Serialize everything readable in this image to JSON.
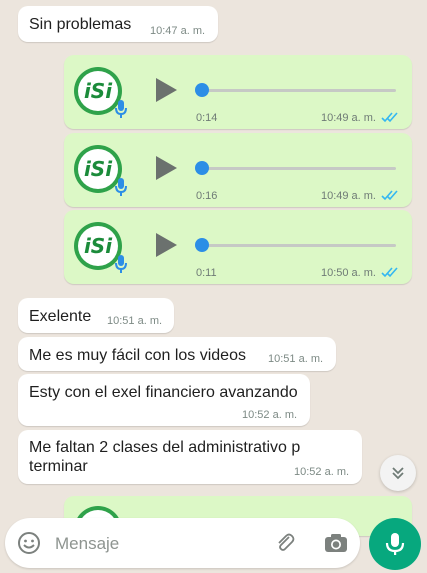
{
  "messages": [
    {
      "text": "Sin problemas",
      "time": "10:47 a. m."
    },
    {
      "text": "Exelente",
      "time": "10:51 a. m."
    },
    {
      "text": "Me es muy fácil con los videos",
      "time": "10:51 a. m."
    },
    {
      "text": "Esty con el exel financiero avanzando",
      "time": "10:52 a. m."
    },
    {
      "text_line1": "Me faltan 2 clases del administrativo p",
      "text_line2": "terminar",
      "time": "10:52 a. m."
    }
  ],
  "voice_notes": [
    {
      "duration": "0:14",
      "time": "10:49 a. m.",
      "avatar_text": "iSi",
      "progress": 0
    },
    {
      "duration": "0:16",
      "time": "10:49 a. m.",
      "avatar_text": "iSi",
      "progress": 0
    },
    {
      "duration": "0:11",
      "time": "10:50 a. m.",
      "avatar_text": "iSi",
      "progress": 0
    }
  ],
  "composer": {
    "placeholder": "Mensaje"
  },
  "colors": {
    "outgoing_bubble": "#dcf8c6",
    "incoming_bubble": "#ffffff",
    "read_ticks": "#34b7f1",
    "accent": "#07a87e",
    "avatar_green": "#2fa24a"
  },
  "icons": [
    "play-icon",
    "mic-icon",
    "double-check-icon",
    "emoji-icon",
    "paperclip-icon",
    "camera-icon",
    "chevron-double-down-icon"
  ]
}
